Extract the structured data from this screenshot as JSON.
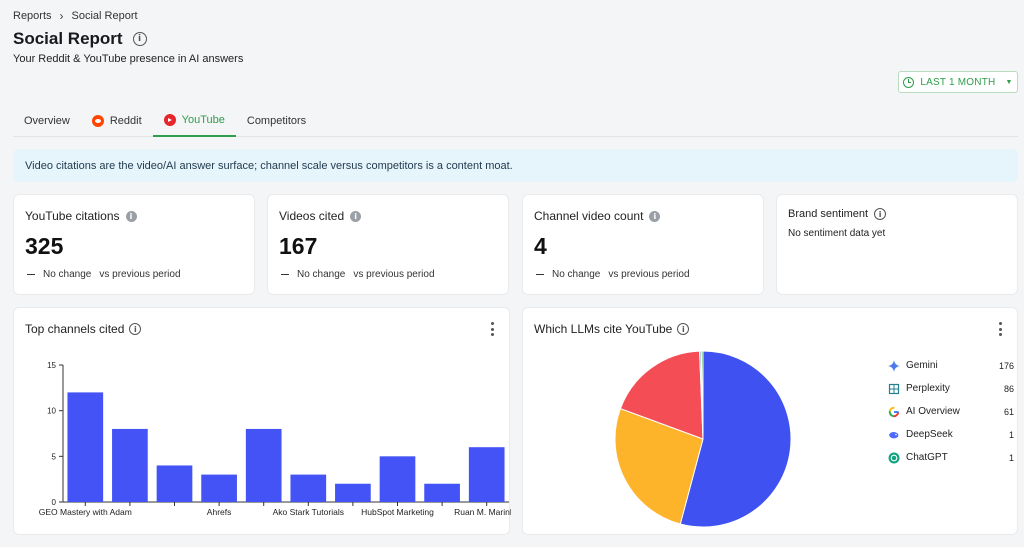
{
  "breadcrumb": {
    "root": "Reports",
    "current": "Social Report"
  },
  "page": {
    "title": "Social Report",
    "subtitle": "Your Reddit & YouTube presence in AI answers",
    "date_filter": "LAST 1 MONTH"
  },
  "tabs": [
    {
      "label": "Overview",
      "icon": ""
    },
    {
      "label": "Reddit",
      "icon": "reddit-icon"
    },
    {
      "label": "YouTube",
      "icon": "youtube-icon",
      "active": true
    },
    {
      "label": "Competitors",
      "icon": ""
    }
  ],
  "banner": "Video citations are the video/AI answer surface; channel scale versus competitors is a content moat.",
  "stats": [
    {
      "label": "YouTube citations",
      "value": "325",
      "change": "No change",
      "compare": "vs previous period"
    },
    {
      "label": "Videos cited",
      "value": "167",
      "change": "No change",
      "compare": "vs previous period"
    },
    {
      "label": "Channel video count",
      "value": "4",
      "change": "No change",
      "compare": "vs previous period"
    }
  ],
  "brand_sentiment": {
    "label": "Brand sentiment",
    "empty": "No sentiment data yet"
  },
  "colors": {
    "accent": "#2e9e4a",
    "bar": "#4353f5",
    "pie": [
      "#3f51f0",
      "#fdb42b",
      "#f44d55",
      "#6fa8dc",
      "#4caf50"
    ]
  },
  "chart_data": [
    {
      "type": "bar",
      "title": "Top channels cited",
      "categories": [
        "GEO Mastery with Adam",
        "",
        "",
        "Ahrefs",
        "",
        "Ako Stark Tutorials",
        "",
        "HubSpot Marketing",
        "",
        "Ruan M. Marinho"
      ],
      "tick_labels": [
        "GEO Mastery with Adam",
        "",
        "",
        "Ahrefs",
        "",
        "Ako Stark Tutorials",
        "",
        "HubSpot Marketing",
        "",
        "Ruan M. Marinho"
      ],
      "values": [
        12,
        8,
        4,
        3,
        8,
        3,
        2,
        5,
        2,
        6
      ],
      "ylim": [
        0,
        15
      ],
      "yticks": [
        "0",
        "5",
        "10",
        "15"
      ],
      "xlabel": "",
      "ylabel": ""
    },
    {
      "type": "pie",
      "title": "Which LLMs cite YouTube",
      "legend_position": "right",
      "slices": [
        {
          "name": "Gemini",
          "value": 176,
          "icon": "gemini-icon"
        },
        {
          "name": "Perplexity",
          "value": 86,
          "icon": "perplexity-icon"
        },
        {
          "name": "AI Overview",
          "value": 61,
          "icon": "google-icon"
        },
        {
          "name": "DeepSeek",
          "value": 1,
          "icon": "deepseek-icon"
        },
        {
          "name": "ChatGPT",
          "value": 1,
          "icon": "chatgpt-icon"
        }
      ]
    }
  ]
}
